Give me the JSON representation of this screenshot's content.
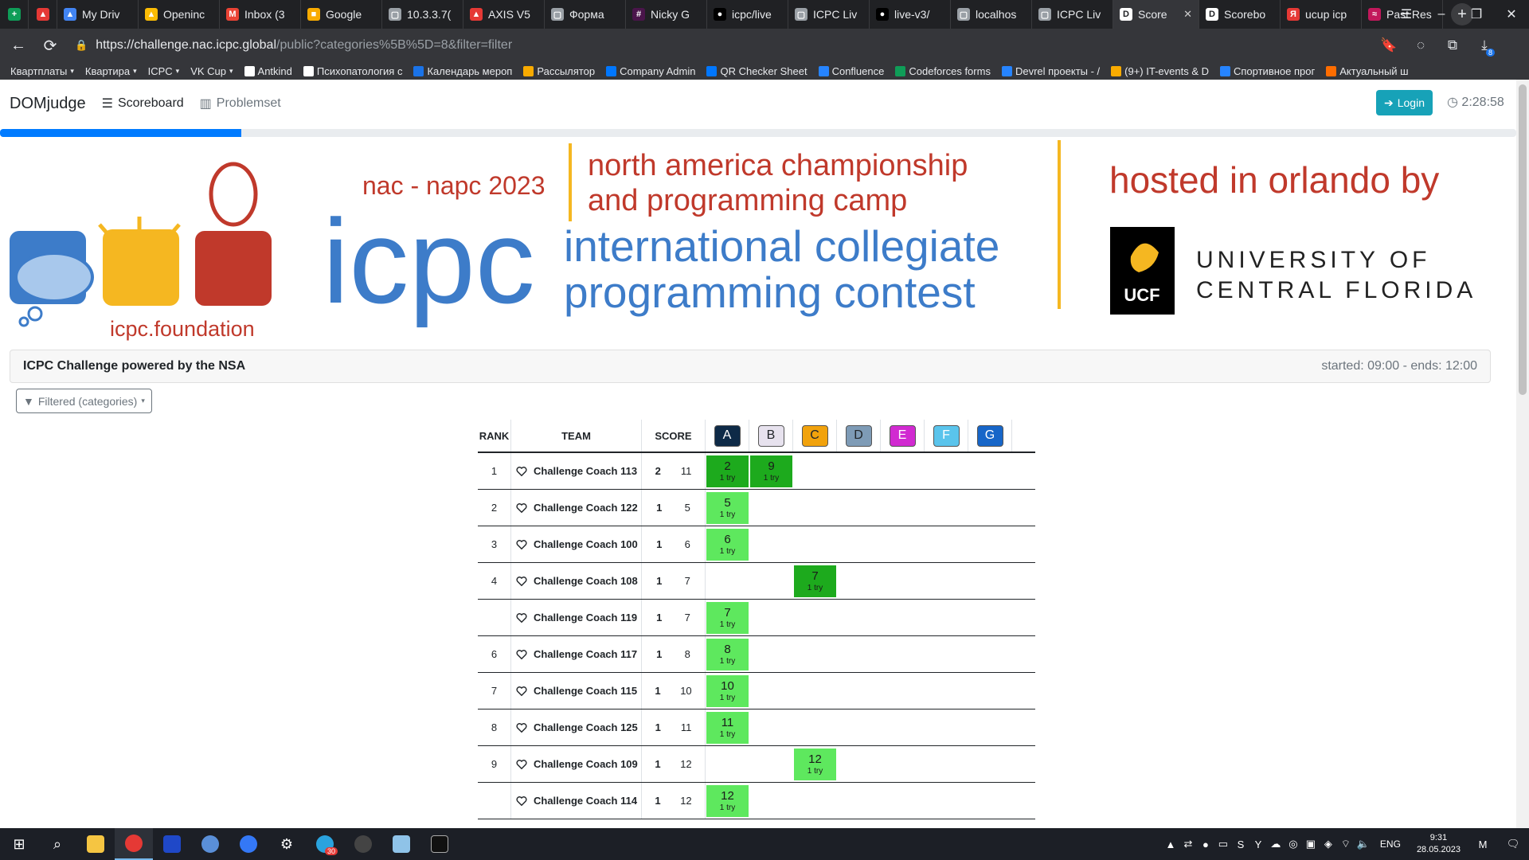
{
  "browser": {
    "tabs": [
      {
        "label": "",
        "color": "#0f9d58",
        "glyph": "+"
      },
      {
        "label": "",
        "color": "#e53935",
        "glyph": "▲"
      },
      {
        "label": "My Driv",
        "color": "#4285f4",
        "glyph": "▲"
      },
      {
        "label": "Openinc",
        "color": "#fbbc04",
        "glyph": "▲"
      },
      {
        "label": "Inbox (3",
        "color": "#ea4335",
        "glyph": "M"
      },
      {
        "label": "Google",
        "color": "#f9ab00",
        "glyph": "■"
      },
      {
        "label": "10.3.3.7(",
        "color": "#9aa0a6",
        "glyph": "▢"
      },
      {
        "label": "AXIS V5",
        "color": "#e53935",
        "glyph": "▲"
      },
      {
        "label": "Форма",
        "color": "#9aa0a6",
        "glyph": "▢"
      },
      {
        "label": "Nicky G",
        "color": "#4a154b",
        "glyph": "#"
      },
      {
        "label": "icpc/live",
        "color": "#000000",
        "glyph": "●"
      },
      {
        "label": "ICPC Liv",
        "color": "#9aa0a6",
        "glyph": "▢"
      },
      {
        "label": "live-v3/",
        "color": "#000000",
        "glyph": "●"
      },
      {
        "label": "localhos",
        "color": "#9aa0a6",
        "glyph": "▢"
      },
      {
        "label": "ICPC Liv",
        "color": "#9aa0a6",
        "glyph": "▢"
      },
      {
        "label": "Score",
        "color": "#ffffff",
        "glyph": "D",
        "active": true
      },
      {
        "label": "Scorebo",
        "color": "#ffffff",
        "glyph": "D"
      },
      {
        "label": "ucup icp",
        "color": "#e53935",
        "glyph": "Я"
      },
      {
        "label": "Past Res",
        "color": "#c2185b",
        "glyph": "≈"
      }
    ],
    "url_host": "https://challenge.nac.icpc.global",
    "url_path": "/public?categories%5B%5D=8&filter=filter",
    "downloads_badge": "8",
    "bookmarks": [
      {
        "label": "Квартплаты",
        "color": "",
        "dropdown": true
      },
      {
        "label": "Квартира",
        "color": "",
        "dropdown": true
      },
      {
        "label": "ICPC",
        "color": "",
        "dropdown": true
      },
      {
        "label": "VK Cup",
        "color": "",
        "dropdown": true
      },
      {
        "label": "Antkind",
        "color": "#ffffff"
      },
      {
        "label": "Психопатология с",
        "color": "#ffffff"
      },
      {
        "label": "Календарь мероп",
        "color": "#1a73e8"
      },
      {
        "label": "Рассылятор",
        "color": "#f9ab00"
      },
      {
        "label": "Company Admin",
        "color": "#0077ff"
      },
      {
        "label": "QR Checker Sheet",
        "color": "#0077ff"
      },
      {
        "label": "Confluence",
        "color": "#2684ff"
      },
      {
        "label": "Codeforces forms",
        "color": "#0f9d58"
      },
      {
        "label": "Devrel проекты - /",
        "color": "#2684ff"
      },
      {
        "label": "(9+) IT-events & D",
        "color": "#f9ab00"
      },
      {
        "label": "Спортивное прог",
        "color": "#2684ff"
      },
      {
        "label": "Актуальный ш",
        "color": "#ff6d00"
      }
    ]
  },
  "app": {
    "brand": "DOMjudge",
    "nav": {
      "scoreboard": "Scoreboard",
      "problemset": "Problemset"
    },
    "login": "Login",
    "clock": "2:28:58",
    "progress_fraction": 0.159
  },
  "banner": {
    "foundation": "icpc.foundation",
    "nac_label": "nac - napc 2023",
    "icpc_word": "icpc",
    "headline_1": "north america championship",
    "headline_2": "and programming camp",
    "subline_1": "international collegiate",
    "subline_2": "programming contest",
    "hosted": "hosted in orlando by",
    "ucf_badge": "UCF",
    "ucf_1": "UNIVERSITY OF",
    "ucf_2": "CENTRAL FLORIDA"
  },
  "contest": {
    "name": "ICPC Challenge powered by the NSA",
    "time": "started: 09:00 - ends: 12:00"
  },
  "filter": {
    "label": "Filtered (categories)"
  },
  "scoreboard": {
    "headers": {
      "rank": "RANK",
      "team": "TEAM",
      "score": "SCORE"
    },
    "problems": [
      {
        "label": "A",
        "color": "#0e2a47",
        "text": "#ffffff"
      },
      {
        "label": "B",
        "color": "#e7e2ee",
        "text": "#212529"
      },
      {
        "label": "C",
        "color": "#f1a20c",
        "text": "#212529"
      },
      {
        "label": "D",
        "color": "#7e9bb6",
        "text": "#212529"
      },
      {
        "label": "E",
        "color": "#d12ad1",
        "text": "#ffffff"
      },
      {
        "label": "F",
        "color": "#5ac4ec",
        "text": "#ffffff"
      },
      {
        "label": "G",
        "color": "#1766c8",
        "text": "#ffffff"
      }
    ],
    "rows": [
      {
        "rank": "1",
        "team": "Challenge Coach 113",
        "solved": "2",
        "penalty": "11",
        "results": [
          {
            "p": 0,
            "time": "2",
            "tries": "1 try",
            "first": true
          },
          {
            "p": 1,
            "time": "9",
            "tries": "1 try",
            "first": true
          }
        ]
      },
      {
        "rank": "2",
        "team": "Challenge Coach 122",
        "solved": "1",
        "penalty": "5",
        "results": [
          {
            "p": 0,
            "time": "5",
            "tries": "1 try",
            "first": false
          }
        ]
      },
      {
        "rank": "3",
        "team": "Challenge Coach 100",
        "solved": "1",
        "penalty": "6",
        "results": [
          {
            "p": 0,
            "time": "6",
            "tries": "1 try",
            "first": false
          }
        ]
      },
      {
        "rank": "4",
        "team": "Challenge Coach 108",
        "solved": "1",
        "penalty": "7",
        "results": [
          {
            "p": 2,
            "time": "7",
            "tries": "1 try",
            "first": true
          }
        ]
      },
      {
        "rank": "",
        "team": "Challenge Coach 119",
        "solved": "1",
        "penalty": "7",
        "results": [
          {
            "p": 0,
            "time": "7",
            "tries": "1 try",
            "first": false
          }
        ]
      },
      {
        "rank": "6",
        "team": "Challenge Coach 117",
        "solved": "1",
        "penalty": "8",
        "results": [
          {
            "p": 0,
            "time": "8",
            "tries": "1 try",
            "first": false
          }
        ]
      },
      {
        "rank": "7",
        "team": "Challenge Coach 115",
        "solved": "1",
        "penalty": "10",
        "results": [
          {
            "p": 0,
            "time": "10",
            "tries": "1 try",
            "first": false
          }
        ]
      },
      {
        "rank": "8",
        "team": "Challenge Coach 125",
        "solved": "1",
        "penalty": "11",
        "results": [
          {
            "p": 0,
            "time": "11",
            "tries": "1 try",
            "first": false
          }
        ]
      },
      {
        "rank": "9",
        "team": "Challenge Coach 109",
        "solved": "1",
        "penalty": "12",
        "results": [
          {
            "p": 2,
            "time": "12",
            "tries": "1 try",
            "first": false
          }
        ]
      },
      {
        "rank": "",
        "team": "Challenge Coach 114",
        "solved": "1",
        "penalty": "12",
        "results": [
          {
            "p": 0,
            "time": "12",
            "tries": "1 try",
            "first": false
          }
        ]
      }
    ]
  },
  "taskbar": {
    "lang": "ENG",
    "time": "9:31",
    "date": "28.05.2023",
    "telegram_badge": "30"
  }
}
